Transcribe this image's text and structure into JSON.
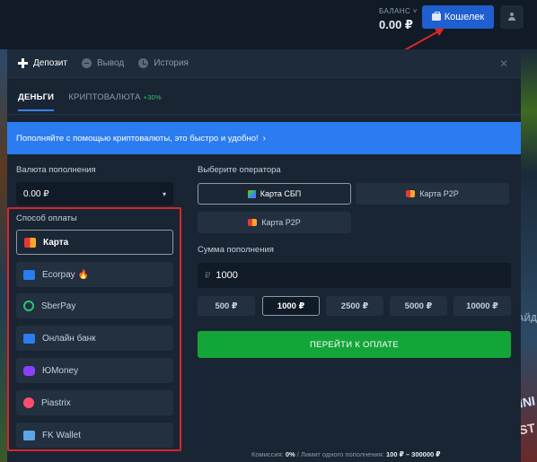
{
  "header": {
    "balance_label": "БАЛАНС ˅",
    "balance_value": "0.00 ₽",
    "wallet_label": "Кошелек"
  },
  "modal": {
    "tabs": [
      {
        "label": "Депозит",
        "icon": "plus-icon"
      },
      {
        "label": "Вывод",
        "icon": "minus-circle-icon"
      },
      {
        "label": "История",
        "icon": "clock-icon"
      }
    ],
    "close": "✕",
    "subtabs": [
      {
        "label": "ДЕНЬГИ"
      },
      {
        "label": "КРИПТОВАЛЮТА",
        "bonus": "+30%"
      }
    ],
    "banner": "Пополняйте с помощью криптовалюты, это быстро и удобно!",
    "currency_label": "Валюта пополнения",
    "currency_value": "0.00 ₽",
    "methods_label": "Способ оплаты",
    "methods": [
      {
        "label": "Карта",
        "color": "#e53935"
      },
      {
        "label": "Ecorpay 🔥",
        "color": "#2b7cf0"
      },
      {
        "label": "SberPay",
        "color": "#28c76f"
      },
      {
        "label": "Онлайн банк",
        "color": "#2b7cf0"
      },
      {
        "label": "ЮMoney",
        "color": "#8b3ffd"
      },
      {
        "label": "Piastrix",
        "color": "#ff4d6d"
      },
      {
        "label": "FK Wallet",
        "color": "#5aa7e8"
      }
    ],
    "operator_label": "Выберите оператора",
    "operators": [
      {
        "label": "Карта СБП",
        "icon": "sbp-icon"
      },
      {
        "label": "Карта P2P",
        "icon": "mastercard-icon"
      },
      {
        "label": "Карта P2P",
        "icon": "mastercard-icon"
      }
    ],
    "amount_label": "Сумма пополнения",
    "amount_currency": "₽",
    "amount_value": "1000",
    "presets": [
      "500 ₽",
      "1000 ₽",
      "2500 ₽",
      "5000 ₽",
      "10000 ₽"
    ],
    "selected_preset": "1000 ₽",
    "pay_label": "ПЕРЕЙТИ К ОПЛАТЕ",
    "footer": {
      "commission_label": "Комиссия:",
      "commission_value": "0%",
      "limit_label": "/ Лимит одного пополнения:",
      "limit_value": "100 ₽ – 300000 ₽"
    }
  },
  "background": {
    "side_text_1": "АЙД",
    "side_text_2": "INI",
    "side_text_3": "ST"
  },
  "colors": {
    "accent": "#1f5fcf",
    "banner": "#2b7cf0",
    "pay_button": "#13a538",
    "highlight_frame": "#d9252b"
  }
}
